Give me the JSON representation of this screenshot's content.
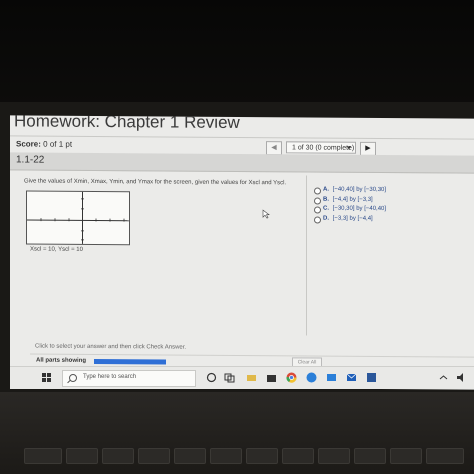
{
  "page": {
    "title": "Homework: Chapter 1 Review",
    "score_label": "Score:",
    "score_value": "0 of 1 pt",
    "progress": "1 of 30 (0 complete)",
    "prev_symbol": "◀",
    "dropdown_symbol": "▼",
    "next_symbol": "▶",
    "question_number": "1.1-22"
  },
  "question": {
    "prompt": "Give the values of Xmin, Xmax, Ymin, and Ymax for the screen, given the values for Xscl and Yscl.",
    "caption": "Xscl = 10, Yscl = 10",
    "options": [
      {
        "letter": "A.",
        "text": "[−40,40] by [−30,30]"
      },
      {
        "letter": "B.",
        "text": "[−4,4] by [−3,3]"
      },
      {
        "letter": "C.",
        "text": "[−30,30] by [−40,40]"
      },
      {
        "letter": "D.",
        "text": "[−3,3] by [−4,4]"
      }
    ]
  },
  "footer": {
    "instruction": "Click to select your answer and then click Check Answer.",
    "parts_label": "All parts showing",
    "parts_progress": 1.0,
    "clear_all": "Clear All"
  },
  "taskbar": {
    "search_placeholder": "Type here to search",
    "icons": [
      "windows-start-icon",
      "cortana-icon",
      "task-view-icon",
      "store-icon",
      "chrome-icon",
      "edge-icon",
      "mail-icon",
      "word-icon"
    ]
  },
  "colors": {
    "option_text": "#2b4a8a",
    "progress_fill": "#2f6fd6",
    "screen_bg": "#ebebe9"
  }
}
